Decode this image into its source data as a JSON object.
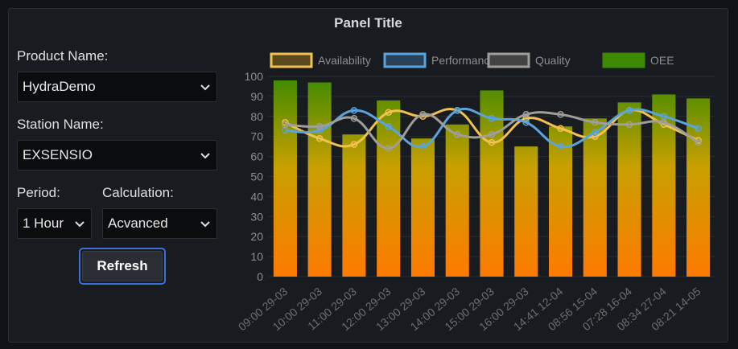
{
  "panel": {
    "title": "Panel Title"
  },
  "controls": {
    "product_label": "Product Name:",
    "product_value": "HydraDemo",
    "station_label": "Station Name:",
    "station_value": "EXSENSIO",
    "period_label": "Period:",
    "period_value": "1 Hour",
    "calculation_label": "Calculation:",
    "calculation_value": "Acvanced",
    "refresh_label": "Refresh"
  },
  "colors": {
    "availability": "#f2c14e",
    "performance": "#5aa4dd",
    "quality": "#a09e9b",
    "oee_top": "#3d8a00",
    "oee_mid": "#c8a000",
    "oee_bottom": "#ff7a00",
    "accent": "#3871dc"
  },
  "chart_data": {
    "type": "bar",
    "title": "",
    "xlabel": "",
    "ylabel": "",
    "ylim": [
      0,
      100
    ],
    "yticks": [
      0,
      10,
      20,
      30,
      40,
      50,
      60,
      70,
      80,
      90,
      100
    ],
    "grid": true,
    "legend_position": "top",
    "categories": [
      "09:00 29-03",
      "10:00 29-03",
      "11:00 29-03",
      "12:00 29-03",
      "13:00 29-03",
      "14:00 29-03",
      "15:00 29-03",
      "16:00 29-03",
      "14:41 12-04",
      "08:56 15-04",
      "07:28 16-04",
      "08:34 27-04",
      "08:21 14-05"
    ],
    "series": [
      {
        "name": "Availability",
        "type": "line",
        "values": [
          77,
          69,
          66,
          82,
          80,
          83,
          67,
          79,
          74,
          70,
          83,
          76,
          68
        ]
      },
      {
        "name": "Performance",
        "type": "line",
        "values": [
          73,
          73,
          83,
          75,
          65,
          83,
          79,
          77,
          65,
          72,
          83,
          80,
          74
        ]
      },
      {
        "name": "Quality",
        "type": "line",
        "values": [
          76,
          75,
          79,
          64,
          81,
          71,
          71,
          81,
          81,
          77,
          76,
          77,
          67
        ]
      },
      {
        "name": "OEE",
        "type": "bar",
        "values": [
          98,
          97,
          71,
          88,
          69,
          76,
          93,
          65,
          75,
          79,
          87,
          91,
          89
        ]
      }
    ]
  }
}
